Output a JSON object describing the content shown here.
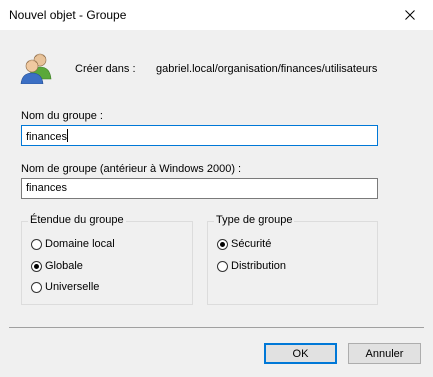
{
  "window": {
    "title": "Nouvel objet - Groupe"
  },
  "header": {
    "create_in_label": "Créer dans :",
    "create_in_path": "gabriel.local/organisation/finances/utilisateurs"
  },
  "group_name": {
    "label": "Nom du groupe :",
    "value": "finances"
  },
  "group_name_pre2000": {
    "label": "Nom de groupe (antérieur à Windows 2000) :",
    "value": "finances"
  },
  "scope": {
    "title": "Étendue du groupe",
    "options": [
      {
        "label": "Domaine local",
        "checked": false
      },
      {
        "label": "Globale",
        "checked": true
      },
      {
        "label": "Universelle",
        "checked": false
      }
    ]
  },
  "type": {
    "title": "Type de groupe",
    "options": [
      {
        "label": "Sécurité",
        "checked": true
      },
      {
        "label": "Distribution",
        "checked": false
      }
    ]
  },
  "buttons": {
    "ok": "OK",
    "cancel": "Annuler"
  }
}
